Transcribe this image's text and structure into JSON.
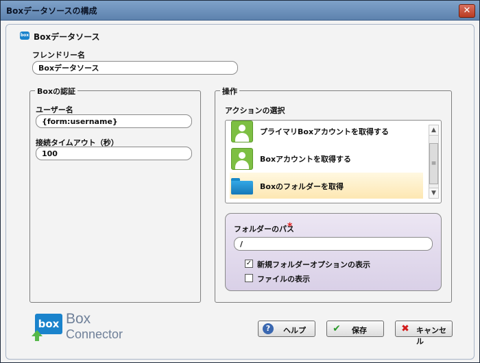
{
  "window": {
    "title": "Boxデータソースの構成",
    "close_symbol": "✕"
  },
  "header": {
    "icon_text": "box",
    "title": "Boxデータソース"
  },
  "friendly_name": {
    "label": "フレンドリー名",
    "value": "Boxデータソース"
  },
  "auth": {
    "legend": "Boxの認証",
    "username_label": "ユーザー名",
    "username_value": "{form:username}",
    "timeout_label": "接続タイムアウト（秒）",
    "timeout_value": "100"
  },
  "operation": {
    "legend": "操作",
    "action_label": "アクションの選択",
    "actions": [
      {
        "label": "プライマリBoxアカウントを取得する",
        "icon": "user-icon"
      },
      {
        "label": "Boxアカウントを取得する",
        "icon": "user-icon"
      },
      {
        "label": "Boxのフォルダーを取得",
        "icon": "folder-icon",
        "selected": true
      }
    ],
    "folder_path_label": "フォルダーのパス",
    "required_mark": "*",
    "folder_path_value": "/",
    "show_new_folder_option": {
      "label": "新規フォルダーオプションの表示",
      "checked": true,
      "mark": "✓"
    },
    "show_files": {
      "label": "ファイルの表示",
      "checked": false
    }
  },
  "logo": {
    "box_text": "box",
    "line1": "Box",
    "line2": "Connector"
  },
  "buttons": {
    "help": {
      "label": "ヘルプ",
      "icon_symbol": "?"
    },
    "save": {
      "label": "保存",
      "icon_symbol": "✔"
    },
    "cancel": {
      "label": "キャンセル",
      "icon_symbol": "✖"
    }
  },
  "colors": {
    "accent_blue": "#1a83cc",
    "required_red": "#e0201c",
    "selected_bg": "#fde7b2",
    "user_green": "#7dbf43"
  }
}
